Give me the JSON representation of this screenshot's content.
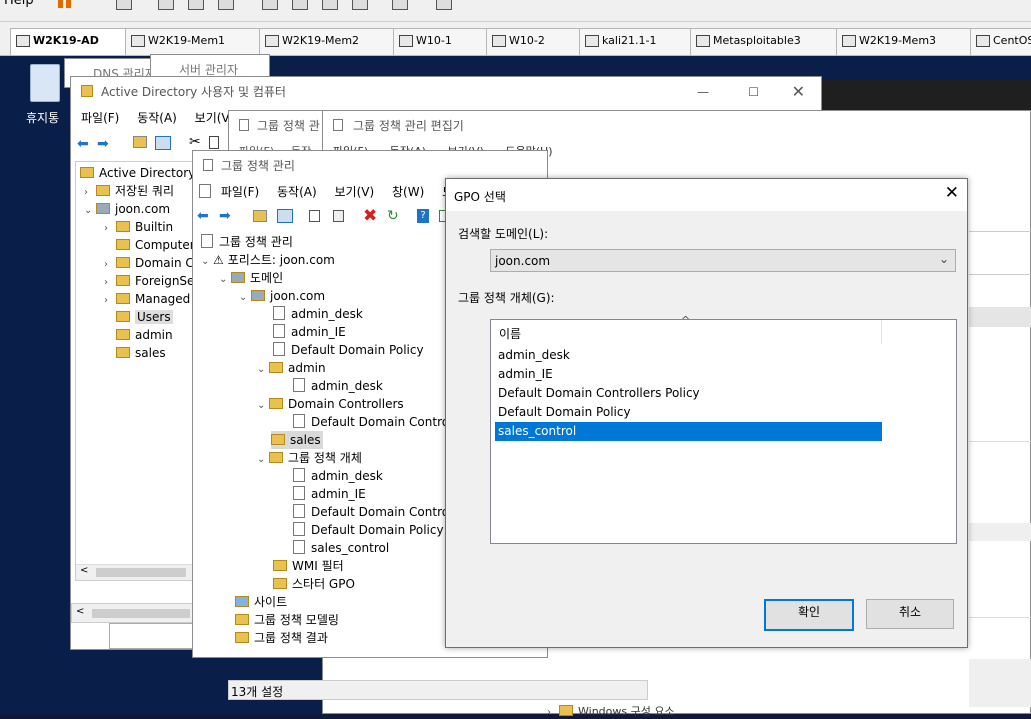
{
  "vm_toolbar": {
    "help_label": "Help"
  },
  "tabs": [
    {
      "label": "W2K19-AD",
      "active": true
    },
    {
      "label": "W2K19-Mem1"
    },
    {
      "label": "W2K19-Mem2"
    },
    {
      "label": "W10-1"
    },
    {
      "label": "W10-2"
    },
    {
      "label": "kali21.1-1"
    },
    {
      "label": "Metasploitable3"
    },
    {
      "label": "W2K19-Mem3"
    },
    {
      "label": "CentOS"
    }
  ],
  "desktop": {
    "recycle_bin_label": "휴지통"
  },
  "windows": {
    "dns_title": "DNS 관리자",
    "server_manager_title": "서버 관리자",
    "ad": {
      "title": "Active Directory 사용자 및 컴퓨터",
      "menu": [
        "파일(F)",
        "동작(A)",
        "보기(V)"
      ],
      "tree": [
        "Active Directory",
        "저장된 쿼리",
        "joon.com",
        "Builtin",
        "Computer",
        "Domain C",
        "ForeignSe",
        "Managed",
        "Users",
        "admin",
        "sales"
      ]
    },
    "gpe": {
      "title": "그룹 정책 관리 편집기",
      "menu": [
        "파일(F)",
        "동작(A)",
        "보기(V)",
        "도움말(H)"
      ],
      "bg_title": "그룹 정책 관",
      "bg_menu": [
        "파일(F)",
        "동작"
      ]
    },
    "gpm": {
      "title": "그룹 정책 관리",
      "menu": [
        "파일(F)",
        "동작(A)",
        "보기(V)",
        "창(W)",
        "도"
      ],
      "tree": {
        "root": "그룹 정책 관리",
        "forest": "포리스트: joon.com",
        "domains": "도메인",
        "domain": "joon.com",
        "links": [
          "admin_desk",
          "admin_IE",
          "Default Domain Policy"
        ],
        "admin_ou": "admin",
        "admin_ou_child": "admin_desk",
        "dc_ou": "Domain Controllers",
        "dc_child": "Default Domain Controll",
        "sales_ou": "sales",
        "gpo_container": "그룹 정책 개체",
        "gpos": [
          "admin_desk",
          "admin_IE",
          "Default Domain Controll",
          "Default Domain Policy",
          "sales_control"
        ],
        "wmi": "WMI 필터",
        "starter": "스타터 GPO",
        "sites": "사이트",
        "modeling": "그룹 정책 모델링",
        "results": "그룹 정책 결과"
      },
      "status": "13개 설정",
      "bottom_item": "Windows 구성 요소"
    }
  },
  "dialog": {
    "title": "GPO 선택",
    "domain_label": "검색할 도메인(L):",
    "domain_value": "joon.com",
    "gpo_label": "그룹 정책 개체(G):",
    "column_header": "이름",
    "items": [
      "admin_desk",
      "admin_IE",
      "Default Domain Controllers Policy",
      "Default Domain Policy",
      "sales_control"
    ],
    "selected_index": 4,
    "ok_label": "확인",
    "cancel_label": "취소",
    "selection_color": "#0078d7"
  }
}
